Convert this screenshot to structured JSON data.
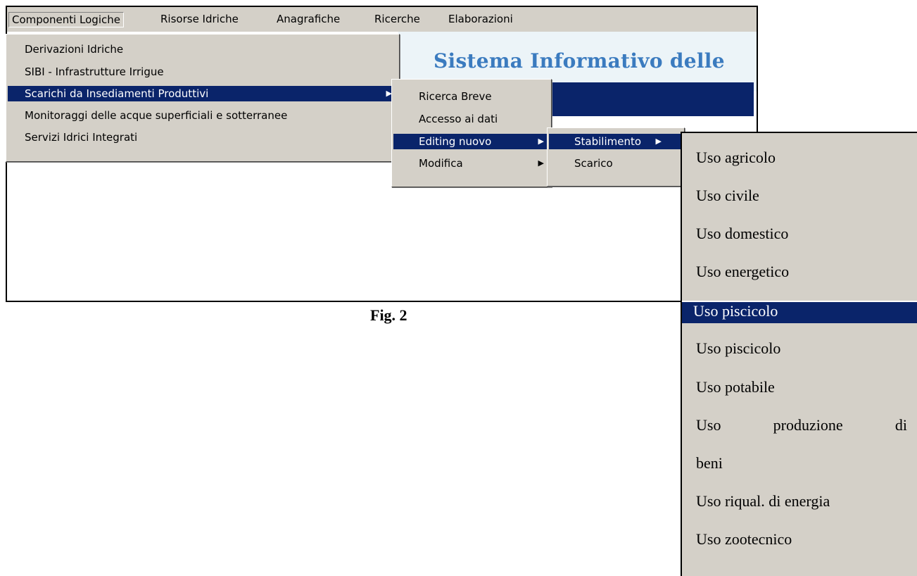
{
  "menubar": {
    "items": [
      "Componenti Logiche",
      "Risorse Idriche",
      "Anagrafiche",
      "Ricerche",
      "Elaborazioni"
    ]
  },
  "banner": {
    "title": "Sistema Informativo delle"
  },
  "menu_componenti": {
    "items": [
      "Derivazioni Idriche",
      "SIBI - Infrastrutture Irrigue",
      "Scarichi da Insediamenti Produttivi",
      "Monitoraggi delle acque superficiali e sotterranee",
      "Servizi Idrici Integrati"
    ]
  },
  "menu_scarichi": {
    "items": [
      "Ricerca Breve",
      "Accesso ai dati",
      "Editing nuovo",
      "Modifica"
    ]
  },
  "menu_editing": {
    "items": [
      "Stabilimento",
      "Scarico"
    ]
  },
  "caption": "Fig. 2",
  "uses": {
    "items": [
      "Uso agricolo",
      "Uso civile",
      "Uso domestico",
      "Uso energetico",
      "Uso piscicolo",
      "Uso piscicolo",
      "Uso potabile",
      "Uso",
      "produzione",
      "di",
      "beni",
      "Uso riqual. di energia",
      "Uso zootecnico"
    ]
  },
  "colors": {
    "menu_bg": "#d4d0c8",
    "selection": "#0a246a",
    "banner_title": "#3b7bbf"
  }
}
